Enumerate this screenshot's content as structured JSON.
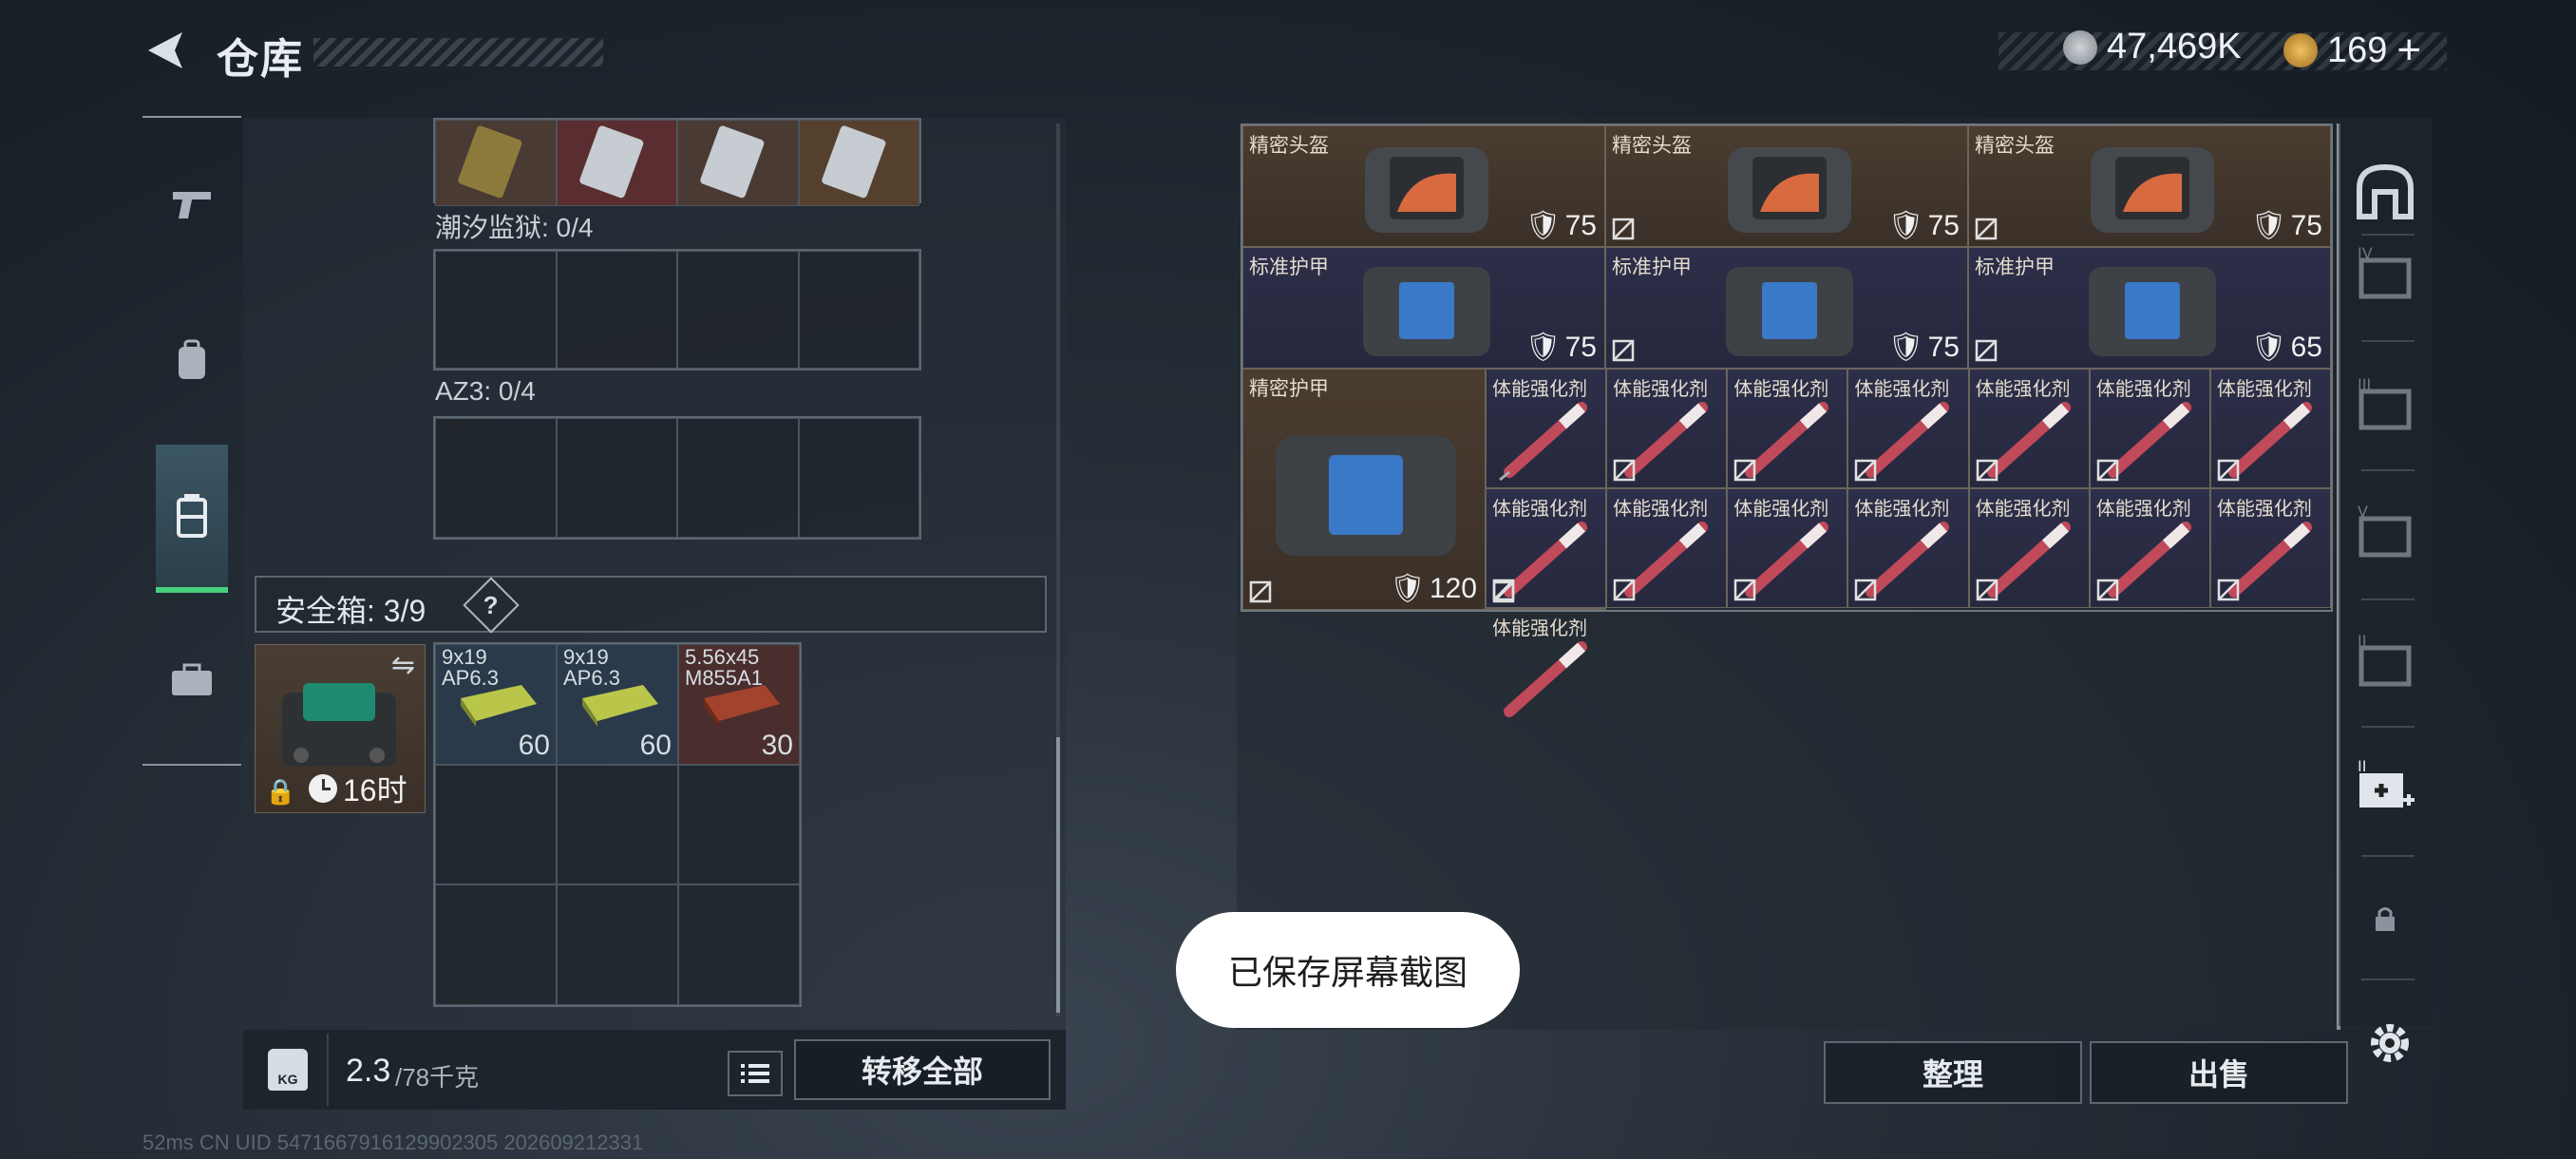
{
  "header": {
    "title": "仓库",
    "back_icon": "back-arrow-icon"
  },
  "currency": {
    "silver": "47,469K",
    "gold": "169",
    "gold_add": "+"
  },
  "left_nav": [
    "weapon-icon",
    "backpack-icon",
    "storage-case-icon",
    "toolbox-icon"
  ],
  "containers": [
    {
      "label": "潮汐监狱: 0/4"
    },
    {
      "label": "AZ3: 0/4"
    }
  ],
  "safe_box": {
    "label": "安全箱: 3/9",
    "help": "?",
    "timer": "16时",
    "ammo": [
      {
        "name": "9x19 AP6.3",
        "count": "60",
        "color": "#b9c64a"
      },
      {
        "name": "9x19 AP6.3",
        "count": "60",
        "color": "#b9c64a"
      },
      {
        "name": "5.56x45 M855A1",
        "count": "30",
        "color": "#a4432d"
      }
    ]
  },
  "weight": {
    "current": "2.3",
    "max": "/78千克",
    "unit_icon": "KG"
  },
  "buttons": {
    "transfer_all": "转移全部",
    "sort": "整理",
    "sell": "出售"
  },
  "stash": {
    "row1": [
      {
        "name": "精密头盔",
        "durability": "75"
      },
      {
        "name": "精密头盔",
        "durability": "75"
      },
      {
        "name": "精密头盔",
        "durability": "75"
      }
    ],
    "row2": [
      {
        "name": "标准护甲",
        "durability": "75"
      },
      {
        "name": "标准护甲",
        "durability": "75"
      },
      {
        "name": "标准护甲",
        "durability": "65"
      }
    ],
    "big": {
      "name": "精密护甲",
      "durability": "120"
    },
    "injector_name": "体能强化剂"
  },
  "toast": "已保存屏幕截图",
  "footer": "52ms CN UID 5471667916129902305 202609212331",
  "colors": {
    "accent_green": "#45d17c",
    "item_brown": "#4a3c30",
    "item_purple": "#2d2f4a"
  }
}
